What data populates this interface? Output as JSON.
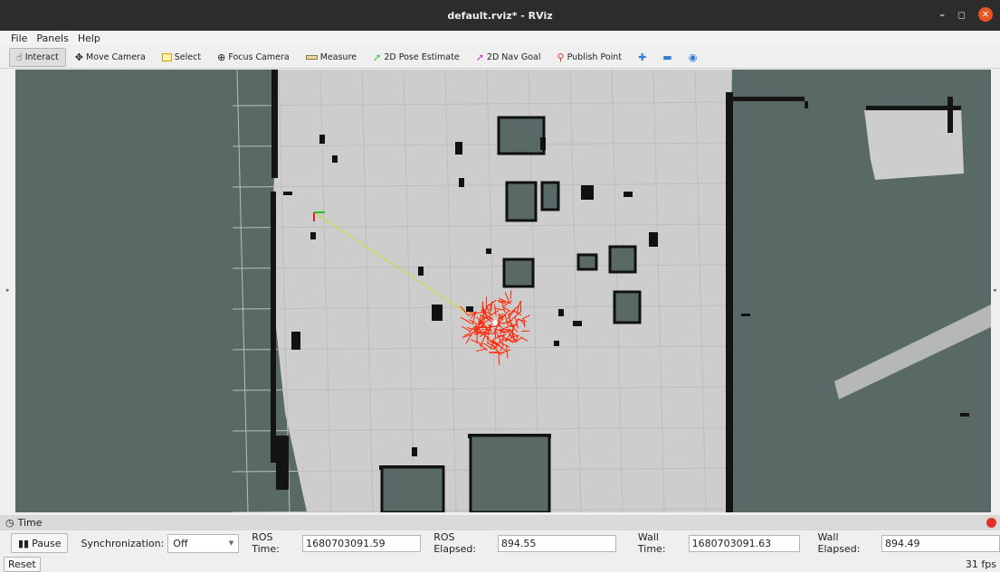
{
  "window": {
    "title": "default.rviz* - RViz",
    "controls": [
      "–",
      "◻",
      "✕"
    ]
  },
  "menu": [
    {
      "label": "File"
    },
    {
      "label": "Panels"
    },
    {
      "label": "Help"
    }
  ],
  "toolbar": {
    "interact": "Interact",
    "move_camera": "Move Camera",
    "select": "Select",
    "focus_camera": "Focus Camera",
    "measure": "Measure",
    "pose_estimate": "2D Pose Estimate",
    "nav_goal": "2D Nav Goal",
    "publish_point": "Publish Point"
  },
  "time_panel": {
    "title": "Time",
    "pause_label": "Pause",
    "sync_label": "Synchronization:",
    "sync_value": "Off",
    "ros_time_label": "ROS Time:",
    "ros_time": "1680703091.59",
    "ros_elapsed_label": "ROS Elapsed:",
    "ros_elapsed": "894.55",
    "wall_time_label": "Wall Time:",
    "wall_time": "1680703091.63",
    "wall_elapsed_label": "Wall Elapsed:",
    "wall_elapsed": "894.49"
  },
  "status": {
    "reset_label": "Reset",
    "fps": "31 fps"
  },
  "colors": {
    "map_free": "#cdcdcd",
    "map_unknown": "#596966",
    "obstacle": "#111111",
    "particles": "#ff2200",
    "titlebar": "#2c2c2c"
  }
}
